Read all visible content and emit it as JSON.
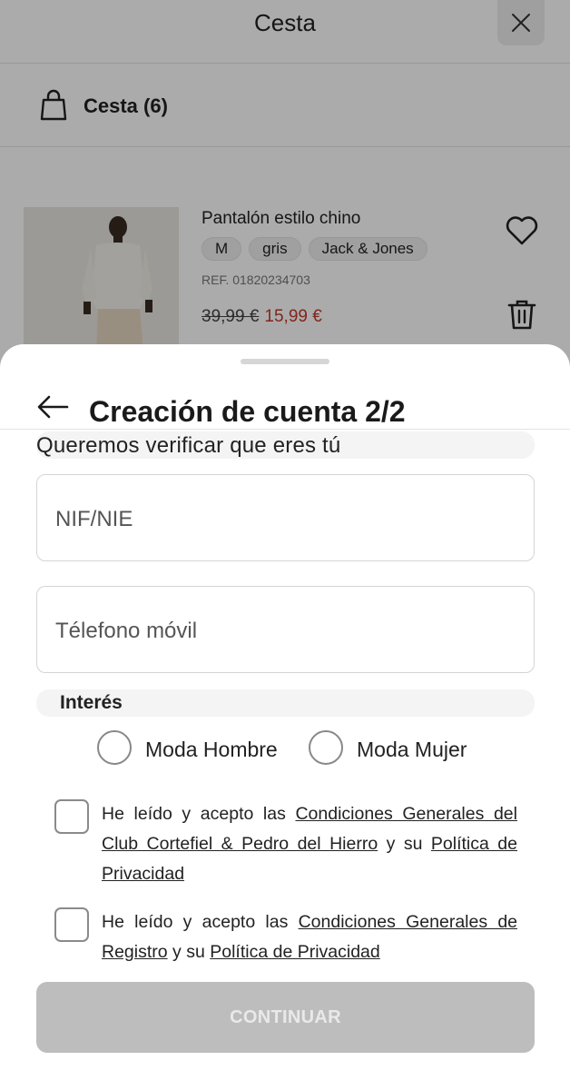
{
  "header": {
    "title": "Cesta"
  },
  "basket": {
    "label": "Cesta (6)"
  },
  "product": {
    "name": "Pantalón estilo chino",
    "chips": [
      "M",
      "gris",
      "Jack & Jones"
    ],
    "ref": "REF. 01820234703",
    "old_price": "39,99 €",
    "new_price": "15,99 €"
  },
  "sheet": {
    "title": "Creación de cuenta 2/2",
    "verify_text": "Queremos verificar que eres tú",
    "nif_placeholder": "NIF/NIE",
    "phone_placeholder": "Télefono móvil",
    "interest_label": "Interés",
    "radio_men": "Moda Hombre",
    "radio_women": "Moda Mujer",
    "consent1": {
      "prefix": "He leído y acepto las ",
      "link1": "Condiciones Generales del Club Cortefiel & Pedro del Hierro",
      "middle": " y su ",
      "link2": "Política de Privacidad"
    },
    "consent2": {
      "prefix": "He leído y acepto las ",
      "link1": "Condiciones Generales de Registro",
      "middle": " y su ",
      "link2": "Política de Privacidad"
    },
    "continue_label": "CONTINUAR"
  },
  "colors": {
    "sale_price": "#c0392b",
    "button_disabled": "#bdbdbd",
    "overlay": "rgba(0,0,0,0.33)"
  }
}
